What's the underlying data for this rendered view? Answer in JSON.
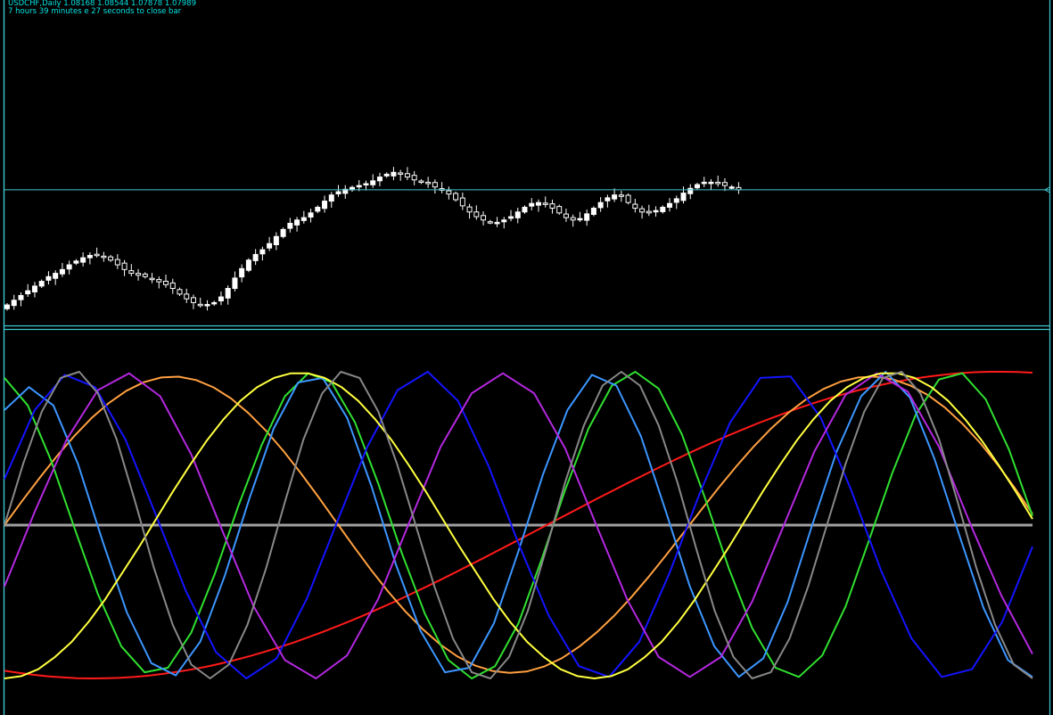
{
  "header": {
    "symbol_line": "USDCHF,Daily  1.08168 1.08544 1.07878 1.07989",
    "countdown": "7 hours 39 minutes e 27 seconds to close bar"
  },
  "colors": {
    "background": "#000000",
    "frame": "#40c8d0",
    "candle": "#ffffff",
    "price_line": "#40c8d0",
    "zero_line": "#a0a0a0"
  },
  "chart_data": [
    {
      "type": "candlestick",
      "title": "USDCHF,Daily",
      "ohlc": [
        1.08168,
        1.08544,
        1.07878,
        1.07989
      ],
      "current_price_line": 1.0799,
      "close_series": [
        1.0555,
        1.0565,
        1.0575,
        1.0585,
        1.0595,
        1.0605,
        1.0615,
        1.0622,
        1.063,
        1.064,
        1.0648,
        1.0655,
        1.066,
        1.0662,
        1.0658,
        1.065,
        1.064,
        1.063,
        1.0622,
        1.0618,
        1.0615,
        1.061,
        1.0604,
        1.0598,
        1.059,
        1.0578,
        1.0568,
        1.056,
        1.0556,
        1.0556,
        1.056,
        1.0572,
        1.059,
        1.0612,
        1.0632,
        1.065,
        1.0662,
        1.0672,
        1.0685,
        1.07,
        1.0715,
        1.0728,
        1.0735,
        1.074,
        1.075,
        1.0762,
        1.0775,
        1.0788,
        1.0795,
        1.08,
        1.0804,
        1.0808,
        1.0812,
        1.0818,
        1.0826,
        1.0832,
        1.0836,
        1.0832,
        1.0826,
        1.082,
        1.0815,
        1.0812,
        1.0805,
        1.0798,
        1.079,
        1.0778,
        1.0765,
        1.0752,
        1.0742,
        1.0735,
        1.073,
        1.073,
        1.0735,
        1.0742,
        1.0752,
        1.0762,
        1.077,
        1.0772,
        1.0768,
        1.076,
        1.075,
        1.074,
        1.0735,
        1.0738,
        1.0748,
        1.076,
        1.0772,
        1.0782,
        1.0788,
        1.0785,
        1.0772,
        1.076,
        1.0752,
        1.075,
        1.0755,
        1.0762,
        1.077,
        1.078,
        1.0792,
        1.0802,
        1.081,
        1.0815,
        1.0815,
        1.0812,
        1.0808,
        1.0805,
        1.0799
      ]
    },
    {
      "type": "line",
      "title": "",
      "zero_line": 0,
      "ylim": [
        -1.25,
        1.25
      ],
      "series": [
        {
          "color": "#ff1a1a",
          "values": [
            -0.95,
            -0.964,
            -0.976,
            -0.986,
            -0.993,
            -0.998,
            -1.0,
            -0.999,
            -0.996,
            -0.99,
            -0.981,
            -0.97,
            -0.956,
            -0.94,
            -0.922,
            -0.901,
            -0.878,
            -0.853,
            -0.825,
            -0.796,
            -0.765,
            -0.731,
            -0.696,
            -0.659,
            -0.621,
            -0.581,
            -0.539,
            -0.497,
            -0.453,
            -0.408,
            -0.362,
            -0.315,
            -0.267,
            -0.219,
            -0.17,
            -0.121,
            -0.072,
            -0.022,
            0.028,
            0.077,
            0.127,
            0.176,
            0.224,
            0.272,
            0.319,
            0.366,
            0.412,
            0.457,
            0.501,
            0.543,
            0.585,
            0.624,
            0.663,
            0.699,
            0.734,
            0.768,
            0.799,
            0.828,
            0.855,
            0.88,
            0.903,
            0.924,
            0.942,
            0.958,
            0.971,
            0.982,
            0.991,
            0.997,
            1.0,
            1.0,
            0.998,
            0.994
          ]
        },
        {
          "color": "#ffa040",
          "values": [
            0.0,
            0.155,
            0.305,
            0.448,
            0.58,
            0.698,
            0.797,
            0.876,
            0.932,
            0.963,
            0.968,
            0.946,
            0.898,
            0.826,
            0.731,
            0.617,
            0.485,
            0.34,
            0.186,
            0.027,
            -0.132,
            -0.286,
            -0.43,
            -0.562,
            -0.678,
            -0.778,
            -0.857,
            -0.915,
            -0.951,
            -0.964,
            -0.954,
            -0.921,
            -0.867,
            -0.792,
            -0.699,
            -0.59,
            -0.467,
            -0.333,
            -0.192,
            -0.046,
            0.101,
            0.245,
            0.383,
            0.512,
            0.63,
            0.733,
            0.819,
            0.888,
            0.936,
            0.963,
            0.968,
            0.95,
            0.91,
            0.848,
            0.764,
            0.659,
            0.535,
            0.394,
            0.239,
            0.074
          ]
        },
        {
          "color": "#30e030",
          "values": [
            0.96,
            0.78,
            0.42,
            -0.02,
            -0.45,
            -0.79,
            -0.96,
            -0.93,
            -0.7,
            -0.32,
            0.12,
            0.52,
            0.84,
            0.99,
            0.93,
            0.67,
            0.27,
            -0.18,
            -0.58,
            -0.88,
            -1.0,
            -0.92,
            -0.64,
            -0.22,
            0.23,
            0.63,
            0.91,
            1.0,
            0.89,
            0.59,
            0.17,
            -0.28,
            -0.67,
            -0.93,
            -0.99,
            -0.85,
            -0.53,
            -0.1,
            0.34,
            0.72,
            0.95,
            0.99,
            0.82,
            0.49,
            0.06
          ]
        },
        {
          "color": "#3c96ff",
          "values": [
            0.75,
            0.9,
            0.78,
            0.4,
            -0.1,
            -0.57,
            -0.9,
            -0.98,
            -0.76,
            -0.33,
            0.17,
            0.63,
            0.93,
            0.96,
            0.7,
            0.25,
            -0.26,
            -0.69,
            -0.96,
            -0.93,
            -0.64,
            -0.17,
            0.33,
            0.75,
            0.98,
            0.91,
            0.58,
            0.1,
            -0.4,
            -0.79,
            -0.99,
            -0.87,
            -0.5,
            0.0,
            0.48,
            0.84,
            1.0,
            0.83,
            0.43,
            -0.06,
            -0.54,
            -0.88,
            -0.99
          ]
        },
        {
          "color": "#1414ff",
          "values": [
            0.3,
            0.75,
            0.98,
            0.9,
            0.56,
            0.07,
            -0.43,
            -0.83,
            -1.0,
            -0.87,
            -0.48,
            0.02,
            0.51,
            0.88,
            1.0,
            0.81,
            0.39,
            -0.12,
            -0.59,
            -0.92,
            -0.99,
            -0.76,
            -0.31,
            0.21,
            0.67,
            0.96,
            0.97,
            0.7,
            0.23,
            -0.3,
            -0.74,
            -0.99,
            -0.94,
            -0.63,
            -0.14
          ]
        },
        {
          "color": "#b428e0",
          "values": [
            -0.4,
            0.1,
            0.56,
            0.88,
            0.99,
            0.84,
            0.46,
            -0.04,
            -0.53,
            -0.88,
            -1.0,
            -0.85,
            -0.48,
            0.02,
            0.51,
            0.86,
            0.99,
            0.86,
            0.5,
            0.0,
            -0.49,
            -0.86,
            -0.99,
            -0.86,
            -0.5,
            -0.01,
            0.48,
            0.85,
            0.99,
            0.87,
            0.51,
            0.01,
            -0.46,
            -0.84
          ]
        },
        {
          "color": "#ffff40",
          "values": [
            -1.0,
            -0.985,
            -0.94,
            -0.86,
            -0.76,
            -0.63,
            -0.48,
            -0.31,
            -0.14,
            0.04,
            0.22,
            0.39,
            0.55,
            0.69,
            0.81,
            0.9,
            0.96,
            0.99,
            0.99,
            0.96,
            0.9,
            0.81,
            0.69,
            0.55,
            0.39,
            0.22,
            0.04,
            -0.14,
            -0.31,
            -0.48,
            -0.63,
            -0.76,
            -0.86,
            -0.94,
            -0.985,
            -1.0,
            -0.985,
            -0.94,
            -0.86,
            -0.76,
            -0.63,
            -0.48,
            -0.31,
            -0.14,
            0.04,
            0.22,
            0.39,
            0.55,
            0.69,
            0.81,
            0.9,
            0.96,
            0.99,
            0.99,
            0.96,
            0.9,
            0.81,
            0.69,
            0.55,
            0.39,
            0.22,
            0.04
          ]
        },
        {
          "color": "#888888",
          "values": [
            0.0,
            0.4,
            0.74,
            0.96,
            1.0,
            0.86,
            0.56,
            0.15,
            -0.28,
            -0.65,
            -0.91,
            -1.0,
            -0.91,
            -0.65,
            -0.28,
            0.15,
            0.56,
            0.86,
            1.0,
            0.96,
            0.74,
            0.4,
            0.0,
            -0.4,
            -0.74,
            -0.96,
            -1.0,
            -0.86,
            -0.56,
            -0.15,
            0.28,
            0.65,
            0.91,
            1.0,
            0.91,
            0.65,
            0.28,
            -0.15,
            -0.56,
            -0.86,
            -1.0,
            -0.96,
            -0.74,
            -0.4,
            0.0,
            0.4,
            0.74,
            0.96,
            1.0,
            0.86,
            0.56,
            0.15,
            -0.28,
            -0.65,
            -0.91,
            -1.0
          ]
        }
      ]
    }
  ]
}
